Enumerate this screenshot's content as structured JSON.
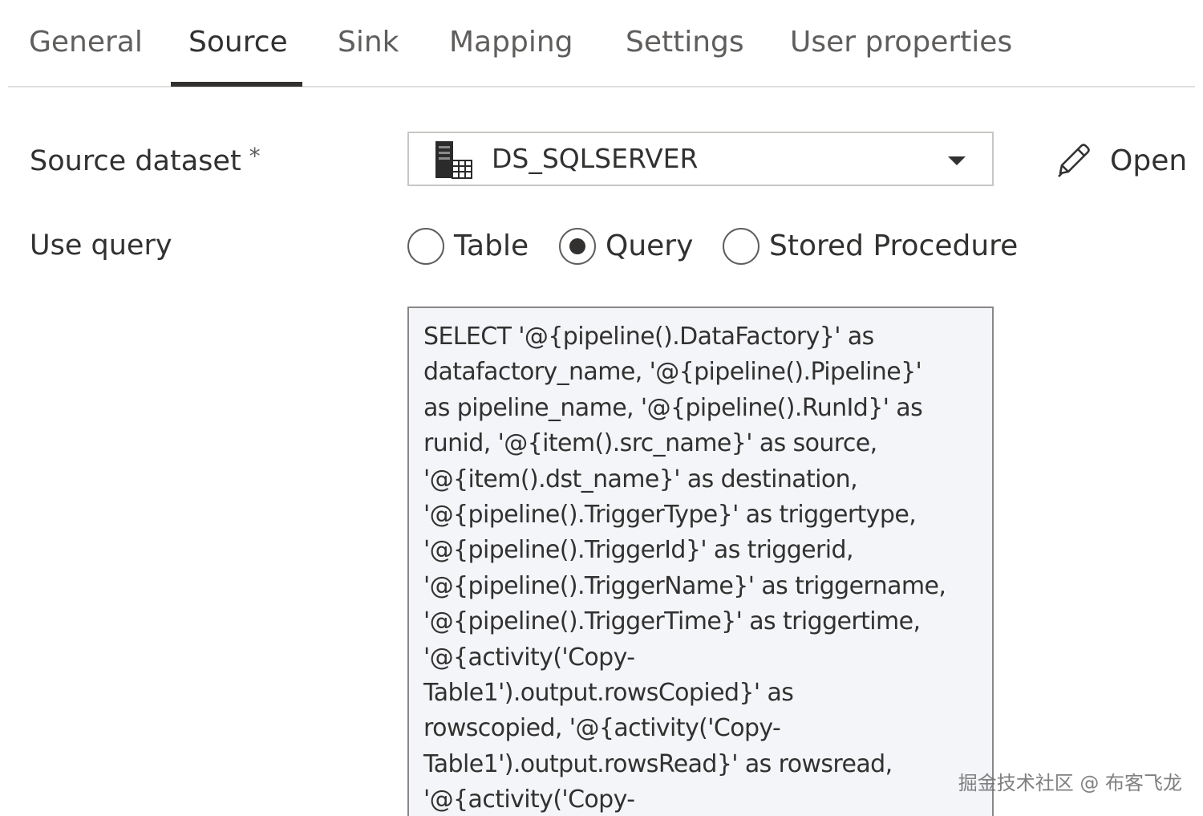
{
  "tabs": [
    {
      "label": "General"
    },
    {
      "label": "Source"
    },
    {
      "label": "Sink"
    },
    {
      "label": "Mapping"
    },
    {
      "label": "Settings"
    },
    {
      "label": "User properties"
    }
  ],
  "active_tab": "Source",
  "source_dataset": {
    "label": "Source dataset",
    "required_mark": "*",
    "value": "DS_SQLSERVER",
    "icon": "sql-server-dataset-icon",
    "open_label": "Open",
    "open_icon": "pencil-icon"
  },
  "use_query": {
    "label": "Use query",
    "options": [
      {
        "label": "Table",
        "selected": false
      },
      {
        "label": "Query",
        "selected": true
      },
      {
        "label": "Stored Procedure",
        "selected": false
      }
    ]
  },
  "query": {
    "lines": [
      "SELECT '@{pipeline().DataFactory}' as",
      "datafactory_name, '@{pipeline().Pipeline}'",
      "as pipeline_name, '@{pipeline().RunId}' as",
      "runid, '@{item().src_name}' as source,",
      "'@{item().dst_name}' as destination,",
      "'@{pipeline().TriggerType}' as triggertype,",
      "'@{pipeline().TriggerId}' as triggerid,",
      "'@{pipeline().TriggerName}' as triggername,",
      "'@{pipeline().TriggerTime}' as triggertime,",
      "'@{activity('Copy-",
      "Table1').output.rowsCopied}' as",
      "rowscopied, '@{activity('Copy-",
      "Table1').output.rowsRead}' as rowsread,",
      "'@{activity('Copy-"
    ]
  },
  "watermark": "掘金技术社区 @ 布客飞龙",
  "colors": {
    "text": "#323130",
    "muted_text": "#605e5c",
    "textarea_bg": "#f3f5f8",
    "border": "#c8c6c4",
    "active_underline": "#323130"
  }
}
